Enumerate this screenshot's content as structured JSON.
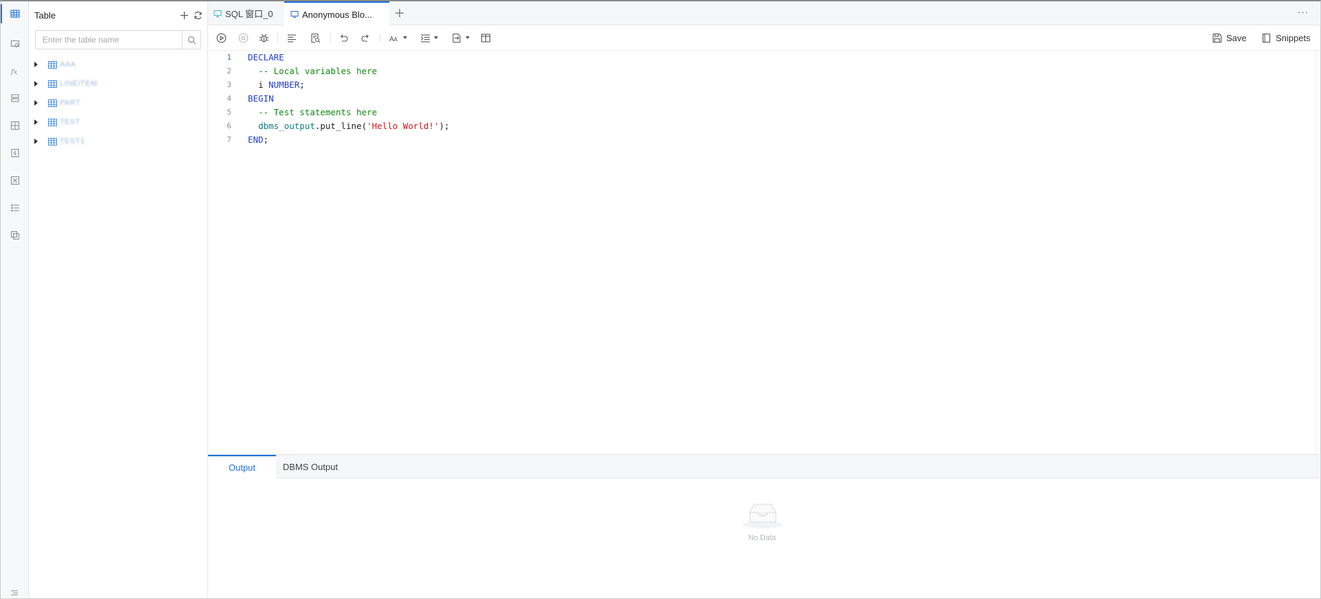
{
  "rail": {
    "items": [
      {
        "name": "table-icon",
        "active": true
      },
      {
        "name": "view-icon",
        "active": false
      },
      {
        "name": "function-icon",
        "active": false
      },
      {
        "name": "procedure-icon",
        "active": false
      },
      {
        "name": "package-icon",
        "active": false
      },
      {
        "name": "trigger-icon",
        "active": false
      },
      {
        "name": "type-icon",
        "active": false
      },
      {
        "name": "sequence-icon",
        "active": false
      },
      {
        "name": "synonym-icon",
        "active": false
      }
    ]
  },
  "table_panel": {
    "title": "Table",
    "search_placeholder": "Enter the table name",
    "tables": [
      {
        "label": "AAA"
      },
      {
        "label": "LINEITEM"
      },
      {
        "label": "PART"
      },
      {
        "label": "TEST"
      },
      {
        "label": "TEST1"
      }
    ]
  },
  "tabs": {
    "items": [
      {
        "label": "SQL 窗口_0",
        "active": false
      },
      {
        "label": "Anonymous Blo...",
        "active": true
      }
    ],
    "more": "···"
  },
  "toolbar": {
    "save_label": "Save",
    "snippets_label": "Snippets"
  },
  "editor": {
    "line_numbers": [
      "1",
      "2",
      "3",
      "4",
      "5",
      "6",
      "7"
    ],
    "lines": {
      "l1_kw": "DECLARE",
      "l2_cm": "-- Local variables here",
      "l3_id": "i ",
      "l3_kw": "NUMBER",
      "l3_end": ";",
      "l4_kw": "BEGIN",
      "l5_cm": "-- Test statements here",
      "l6_fn": "dbms_output",
      "l6_mid": ".put_line(",
      "l6_str": "'Hello World!'",
      "l6_end": ");",
      "l7_kw": "END",
      "l7_end": ";"
    }
  },
  "output": {
    "tabs": [
      "Output",
      "DBMS Output"
    ],
    "active_tab": "Output",
    "empty_text": "No Data"
  },
  "colors": {
    "accent": "#1a6fdc",
    "keyword": "#1f3fcf",
    "comment": "#108a10",
    "string": "#d31a1a",
    "function": "#0e7c86"
  }
}
